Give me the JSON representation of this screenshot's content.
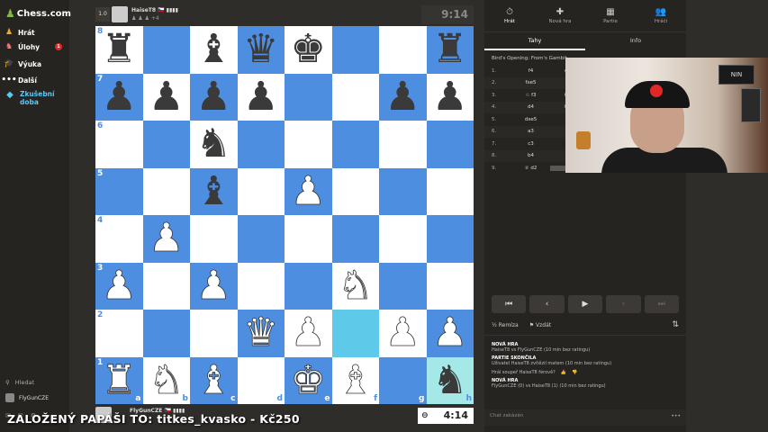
{
  "sidebar": {
    "logo": "Chess.com",
    "items": [
      {
        "label": "Hrát",
        "icon": "play-icon",
        "badge": ""
      },
      {
        "label": "Úlohy",
        "icon": "puzzle-icon",
        "badge": "1"
      },
      {
        "label": "Výuka",
        "icon": "learn-icon",
        "badge": ""
      },
      {
        "label": "Další",
        "icon": "more-icon",
        "badge": ""
      }
    ],
    "premium": "Zkušební doba",
    "search": "Hledat",
    "username": "FlyGunCZE"
  },
  "top_player": {
    "rating": "1.0",
    "name": "HaiseT8 🇨🇿 ▮▮▮▮",
    "material": "♟ ♟ ♟ +4",
    "clock": "9:14"
  },
  "bottom_player": {
    "name": "FlyGunCZE 🇨🇿 ▮▮▮▮",
    "clock": "4:14"
  },
  "board": {
    "ranks": [
      "8",
      "7",
      "6",
      "5",
      "4",
      "3",
      "2",
      "1"
    ],
    "files": [
      "a",
      "b",
      "c",
      "d",
      "e",
      "f",
      "g",
      "h"
    ],
    "rows": [
      [
        [
          "b",
          "♜"
        ],
        null,
        [
          "b",
          "♝"
        ],
        [
          "b",
          "♛"
        ],
        [
          "b",
          "♚"
        ],
        null,
        null,
        [
          "b",
          "♜"
        ]
      ],
      [
        [
          "b",
          "♟"
        ],
        [
          "b",
          "♟"
        ],
        [
          "b",
          "♟"
        ],
        [
          "b",
          "♟"
        ],
        null,
        null,
        [
          "b",
          "♟"
        ],
        [
          "b",
          "♟"
        ]
      ],
      [
        null,
        null,
        [
          "b",
          "♞"
        ],
        null,
        null,
        null,
        null,
        null
      ],
      [
        null,
        null,
        [
          "b",
          "♝"
        ],
        null,
        [
          "w",
          "♟"
        ],
        null,
        null,
        null
      ],
      [
        null,
        [
          "w",
          "♟"
        ],
        null,
        null,
        null,
        null,
        null,
        null
      ],
      [
        [
          "w",
          "♟"
        ],
        null,
        [
          "w",
          "♟"
        ],
        null,
        null,
        [
          "w",
          "♞"
        ],
        null,
        null
      ],
      [
        null,
        null,
        null,
        [
          "w",
          "♛"
        ],
        [
          "w",
          "♟"
        ],
        null,
        [
          "w",
          "♟"
        ],
        [
          "w",
          "♟"
        ]
      ],
      [
        [
          "w",
          "♜"
        ],
        [
          "w",
          "♞"
        ],
        [
          "w",
          "♝"
        ],
        null,
        [
          "w",
          "♚"
        ],
        [
          "w",
          "♝"
        ],
        null,
        [
          "b",
          "♞"
        ]
      ]
    ],
    "highlights": [
      {
        "r": 6,
        "c": 5,
        "k": "hl"
      },
      {
        "r": 7,
        "c": 7,
        "k": "hl2"
      }
    ]
  },
  "overlay_text": "ZALOŽENÝ PAPÁŠI TO: titkes_kvasko - Kč250",
  "right_panel": {
    "top_icons": [
      {
        "label": "Hrát",
        "glyph": "⏱"
      },
      {
        "label": "Nová hra",
        "glyph": "✚"
      },
      {
        "label": "Partie",
        "glyph": "▦"
      },
      {
        "label": "Hráči",
        "glyph": "👥"
      }
    ],
    "tabs": [
      "Tahy",
      "Info"
    ],
    "opening": "Bird's Opening: From's Gambit,",
    "moves": [
      {
        "n": "1.",
        "w": "f4",
        "b": "e5"
      },
      {
        "n": "2.",
        "w": "fxe5",
        "b": "♘ c6"
      },
      {
        "n": "3.",
        "w": "♘ f3",
        "b": "f6"
      },
      {
        "n": "4.",
        "w": "d4",
        "b": "fxe5"
      },
      {
        "n": "5.",
        "w": "dxe5",
        "b": "♗ c5"
      },
      {
        "n": "6.",
        "w": "a3",
        "b": "♘ h6"
      },
      {
        "n": "7.",
        "w": "c3",
        "b": "♗ g4"
      },
      {
        "n": "8.",
        "w": "b4",
        "b": "♘ f2"
      },
      {
        "n": "9.",
        "w": "♕ d2",
        "b": "♘ xh"
      }
    ],
    "controls": [
      "⏮",
      "‹",
      "▶",
      "›",
      "⏭"
    ],
    "actions": {
      "draw": "Remíza",
      "resign": "Vzdát",
      "flip": "⇅"
    },
    "log": [
      {
        "h": "NOVÁ HRA",
        "t": "HaiseT8 vs FlyGunCZE (10 min bez ratingu)"
      },
      {
        "h": "PARTIE SKONČILA",
        "t": "Uživatel HaiseT8 zvítězil matem (10 min bez ratingu)"
      },
      {
        "h": "",
        "t": "Hrál soupeř HaiseT8 férově?"
      },
      {
        "h": "NOVÁ HRA",
        "t": "FlyGunCZE (0) vs HaiseT8 (1) (10 min bez ratingu)"
      }
    ],
    "chat_placeholder": "Chat zakázán"
  },
  "webcam": {
    "poster": "NIN"
  }
}
